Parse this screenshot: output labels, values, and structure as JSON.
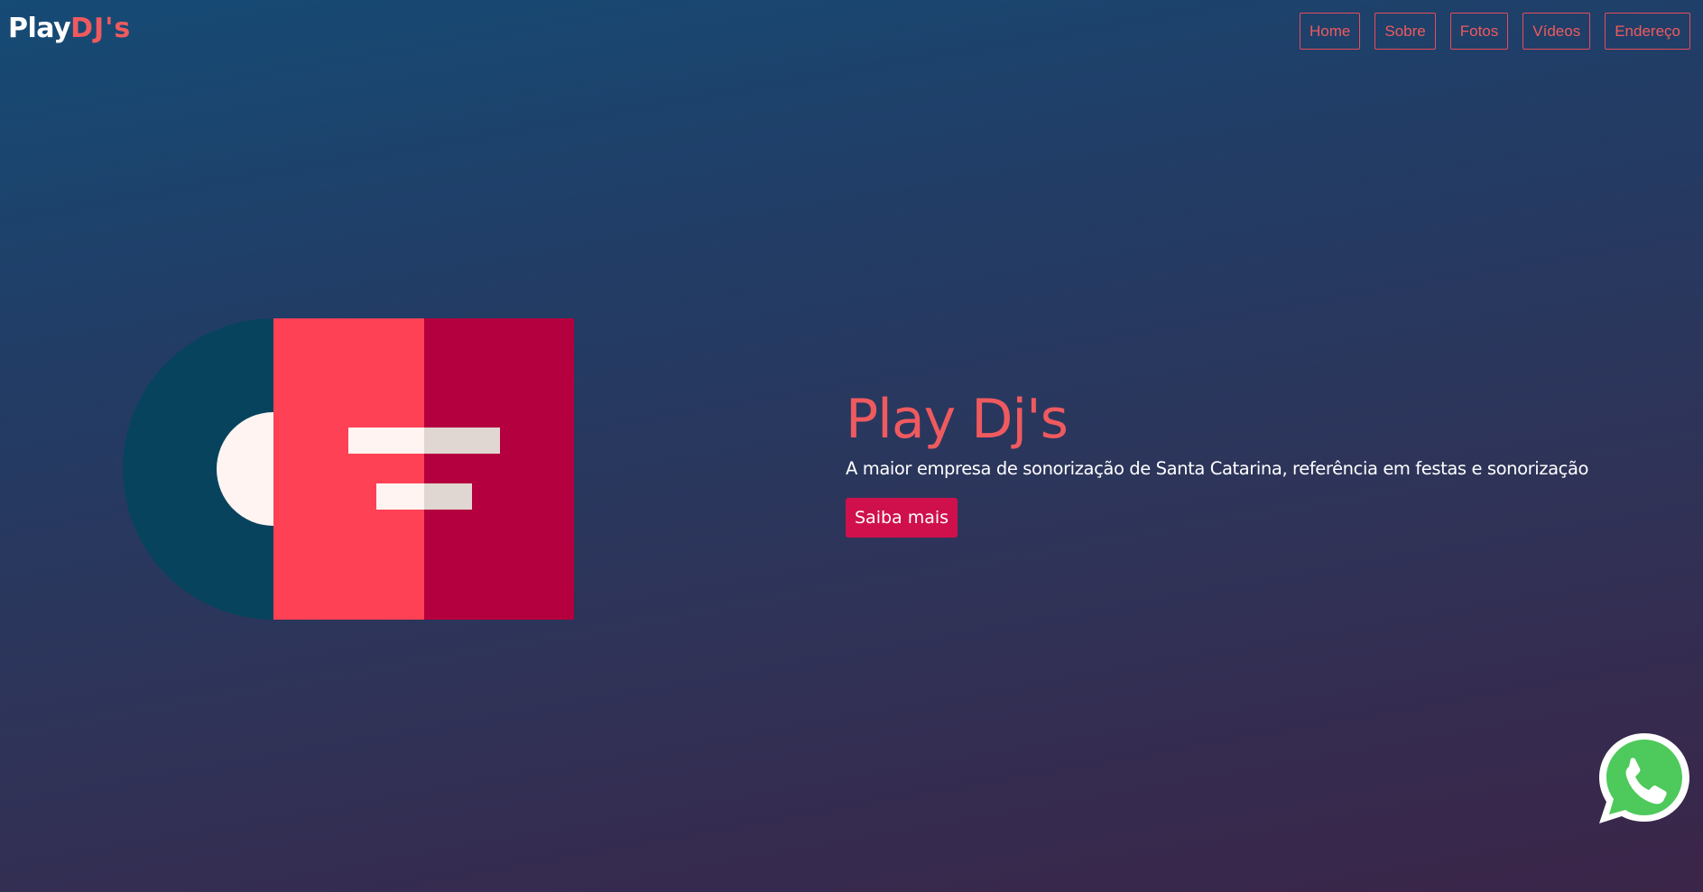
{
  "header": {
    "logo_part1": "Play",
    "logo_part2": "DJ's",
    "nav": [
      {
        "label": "Home"
      },
      {
        "label": "Sobre"
      },
      {
        "label": "Fotos"
      },
      {
        "label": "Vídeos"
      },
      {
        "label": "Endereço"
      }
    ]
  },
  "hero": {
    "title": "Play Dj's",
    "subtitle": "A maior empresa de sonorização de Santa Catarina, referência em festas e sonorização",
    "button_label": "Saiba mais"
  },
  "floating": {
    "icon": "whatsapp-icon"
  },
  "colors": {
    "accent": "#ef5a5f",
    "button": "#d0104d",
    "record": "#08435d",
    "sleeve_left": "#ff4156",
    "sleeve_right": "#b5003f",
    "whatsapp": "#4ec95c"
  }
}
